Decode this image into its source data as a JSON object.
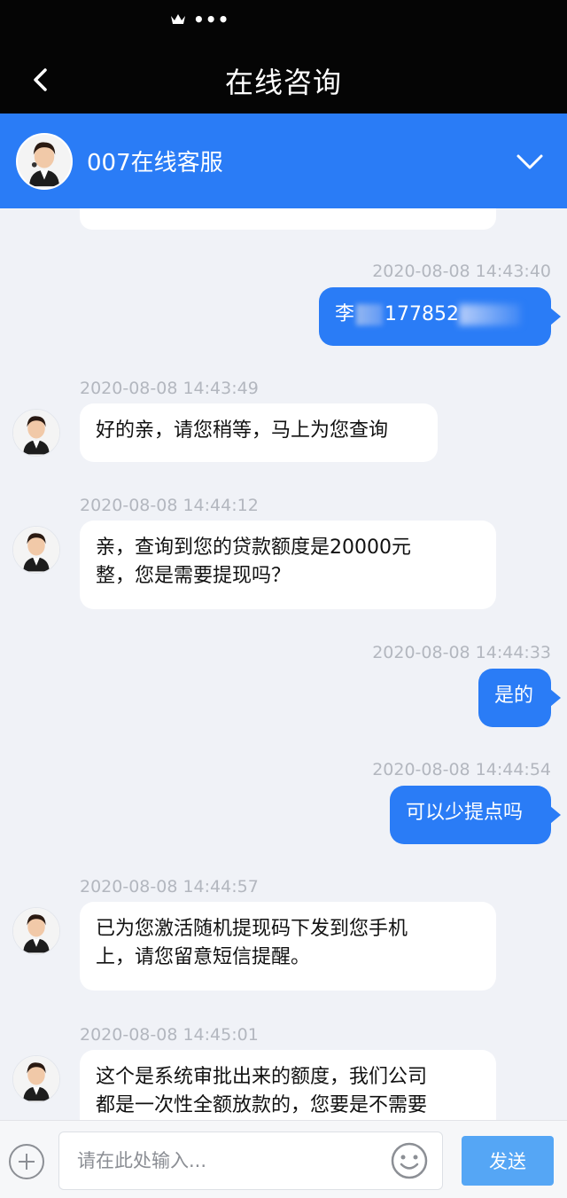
{
  "header": {
    "title": "在线咨询",
    "status_more": "•••"
  },
  "agent": {
    "name": "007在线客服"
  },
  "messages": [
    {
      "time": "2020-08-08 14:43:40",
      "direction": "out",
      "text_prefix": "李",
      "text_middle": "177852"
    },
    {
      "time": "2020-08-08 14:43:49",
      "direction": "in",
      "text": "好的亲，请您稍等，马上为您查询"
    },
    {
      "time": "2020-08-08 14:44:12",
      "direction": "in",
      "line1": "亲，查询到您的贷款额度是20000元",
      "line2": "整，您是需要提现吗？"
    },
    {
      "time": "2020-08-08 14:44:33",
      "direction": "out",
      "text": "是的"
    },
    {
      "time": "2020-08-08 14:44:54",
      "direction": "out",
      "text": "可以少提点吗"
    },
    {
      "time": "2020-08-08 14:44:57",
      "direction": "in",
      "line1": "已为您激活随机提现码下发到您手机",
      "line2": "上，请您留意短信提醒。"
    },
    {
      "time": "2020-08-08 14:45:01",
      "direction": "in",
      "line1": "这个是系统审批出来的额度，我们公司",
      "line2": "都是一次性全额放款的，您要是不需要"
    }
  ],
  "input": {
    "placeholder": "请在此处输入...",
    "send_label": "发送"
  },
  "colors": {
    "accent": "#2a7cf6",
    "top_bar": "#050505",
    "background": "#f0f2f7",
    "send_button": "#55a6f5"
  },
  "icons": [
    "crown-icon",
    "back-arrow-icon",
    "chevron-down-icon",
    "plus-icon",
    "emoji-icon"
  ]
}
